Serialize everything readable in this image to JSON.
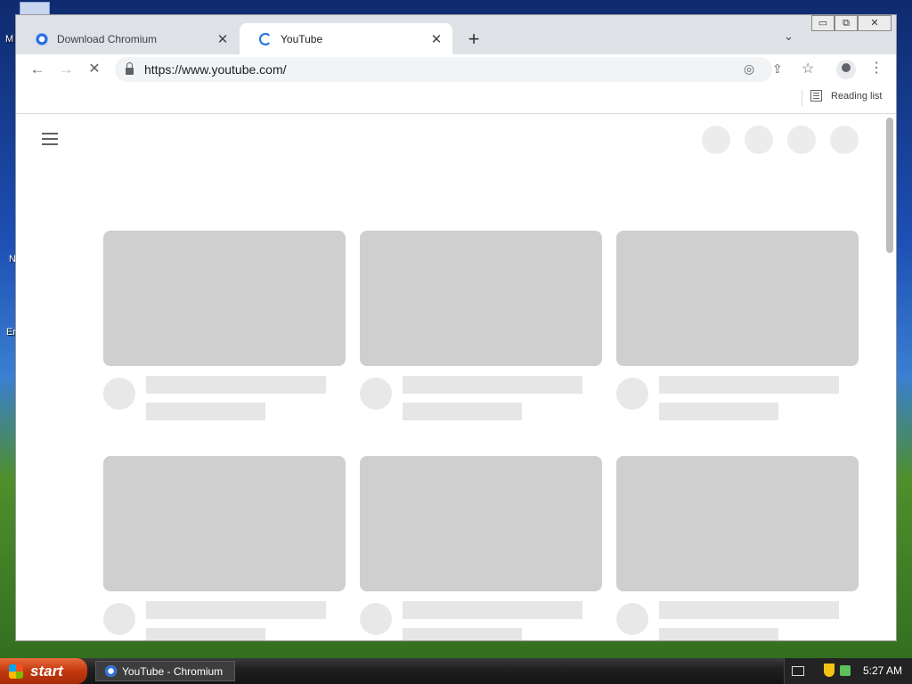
{
  "desktop": {
    "labels": [
      "M",
      "N",
      "Er"
    ]
  },
  "window": {
    "controls": {
      "minimize": "▭",
      "maximize": "⧉",
      "close": "✕"
    }
  },
  "tabs": [
    {
      "title": "Download Chromium",
      "close": "✕",
      "icon": "chromium-icon"
    },
    {
      "title": "YouTube",
      "close": "✕",
      "icon": "loading-spinner-icon",
      "active": true
    }
  ],
  "tabstrip": {
    "new_tab": "+",
    "tab_search": "⌄"
  },
  "toolbar": {
    "back": "←",
    "forward": "→",
    "stop": "✕",
    "url": "https://www.youtube.com/",
    "eye": "◎",
    "share": "⇪",
    "star": "☆",
    "menu": "⋮"
  },
  "bookmarks": {
    "reading_list": "Reading list"
  },
  "taskbar": {
    "start": "start",
    "task": "YouTube - Chromium",
    "clock": "5:27 AM"
  }
}
